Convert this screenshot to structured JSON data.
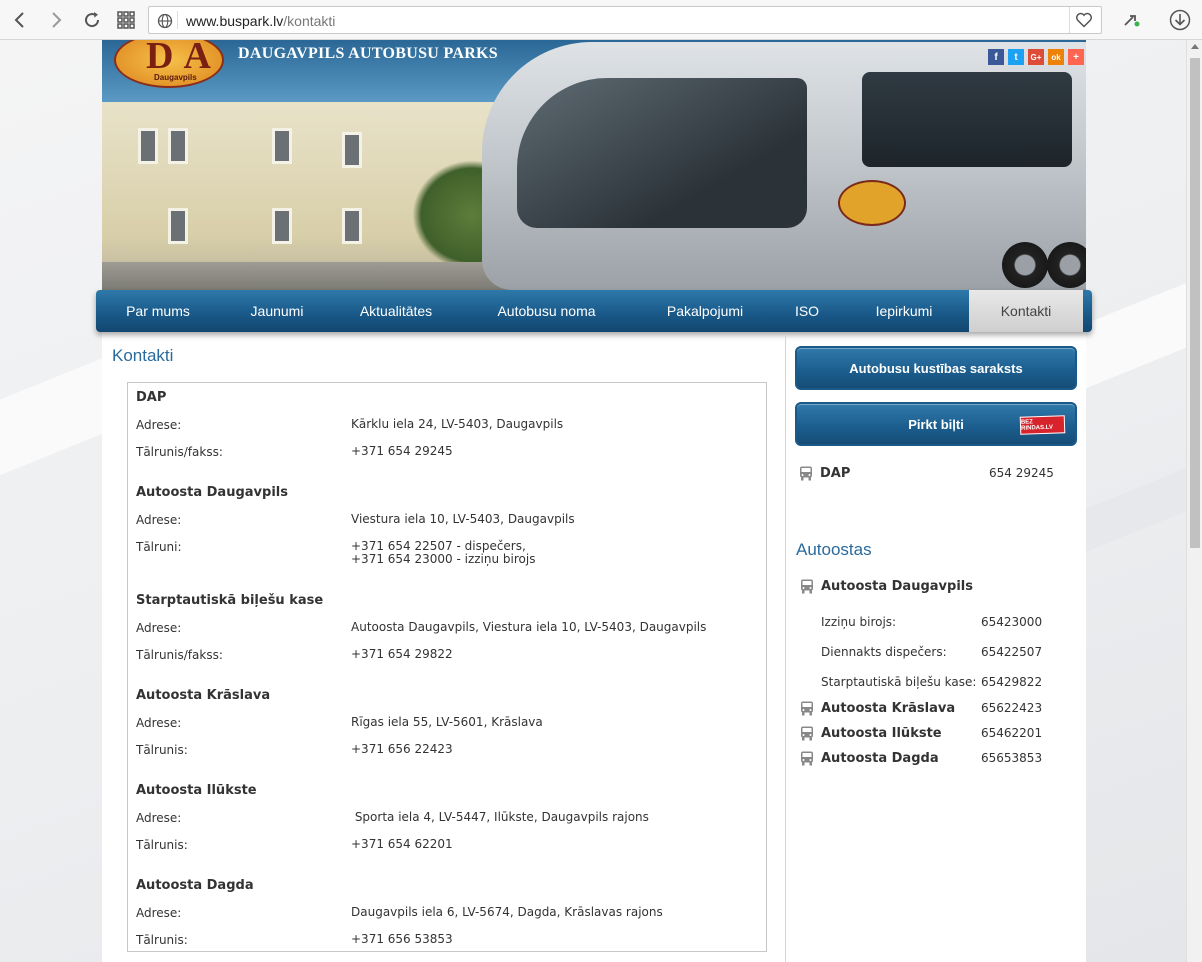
{
  "browser": {
    "url_host": "www.buspark.lv",
    "url_path": "/kontakti"
  },
  "header": {
    "site_title": "DAUGAVPILS AUTOBUSU PARKS",
    "logo_letters": "DAP",
    "logo_sub": "Daugavpils",
    "social": [
      "f",
      "t",
      "G+",
      "ok",
      "+"
    ]
  },
  "nav": {
    "items": [
      {
        "label": "Par mums"
      },
      {
        "label": "Jaunumi"
      },
      {
        "label": "Aktualitātes"
      },
      {
        "label": "Autobusu noma"
      },
      {
        "label": "Pakalpojumi"
      },
      {
        "label": "ISO"
      },
      {
        "label": "Iepirkumi"
      },
      {
        "label": "Kontakti"
      }
    ],
    "active": "Kontakti"
  },
  "content": {
    "title": "Kontakti",
    "sections": [
      {
        "name": "DAP",
        "rows": [
          {
            "label": "Adrese:",
            "value": "Kārklu iela 24, LV-5403, Daugavpils"
          },
          {
            "label": "Tālrunis/fakss:",
            "value": "+371 654 29245"
          }
        ]
      },
      {
        "name": "Autoosta Daugavpils",
        "rows": [
          {
            "label": "Adrese:",
            "value": "Viestura iela 10, LV-5403, Daugavpils"
          },
          {
            "label": "Tālruni:",
            "value": "+371 654 22507 - dispečers,",
            "value2": "+371 654 23000 - izziņu birojs"
          }
        ]
      },
      {
        "name": "Starptautiskā biļešu kase",
        "rows": [
          {
            "label": "Adrese:",
            "value": "Autoosta Daugavpils, Viestura iela 10, LV-5403, Daugavpils"
          },
          {
            "label": "Tālrunis/fakss:",
            "value": "+371 654 29822"
          }
        ]
      },
      {
        "name": "Autoosta Krāslava",
        "rows": [
          {
            "label": "Adrese:",
            "value": "Rīgas iela 55, LV-5601, Krāslava"
          },
          {
            "label": "Tālrunis:",
            "value": "+371 656 22423"
          }
        ]
      },
      {
        "name": "Autoosta Ilūkste",
        "rows": [
          {
            "label": "Adrese:",
            "value": " Sporta iela 4, LV-5447, Ilūkste, Daugavpils rajons"
          },
          {
            "label": "Tālrunis:",
            "value": "+371 654 62201"
          }
        ]
      },
      {
        "name": "Autoosta Dagda",
        "rows": [
          {
            "label": "Adrese:",
            "value": "Daugavpils iela 6, LV-5674, Dagda, Krāslavas rajons"
          },
          {
            "label": "Tālrunis:",
            "value": "+371 656 53853"
          }
        ]
      }
    ]
  },
  "sidebar": {
    "schedule_button": "Autobusu kustības saraksts",
    "buy_button": "Pirkt biļti",
    "buy_badge": "BEZ RINDAS.LV",
    "dap_name": "DAP",
    "dap_phone": "654 29245",
    "stations_title": "Autoostas",
    "main_station": {
      "name": "Autoosta Daugavpils",
      "rows": [
        {
          "label": "Izziņu birojs:",
          "value": "65423000"
        },
        {
          "label": "Diennakts dispečers:",
          "value": "65422507"
        },
        {
          "label": "Starptautiskā biļešu kase:",
          "value": "65429822"
        }
      ]
    },
    "stations": [
      {
        "name": "Autoosta Krāslava",
        "phone": "65622423"
      },
      {
        "name": "Autoosta Ilūkste",
        "phone": "65462201"
      },
      {
        "name": "Autoosta Dagda",
        "phone": "65653853"
      }
    ]
  }
}
